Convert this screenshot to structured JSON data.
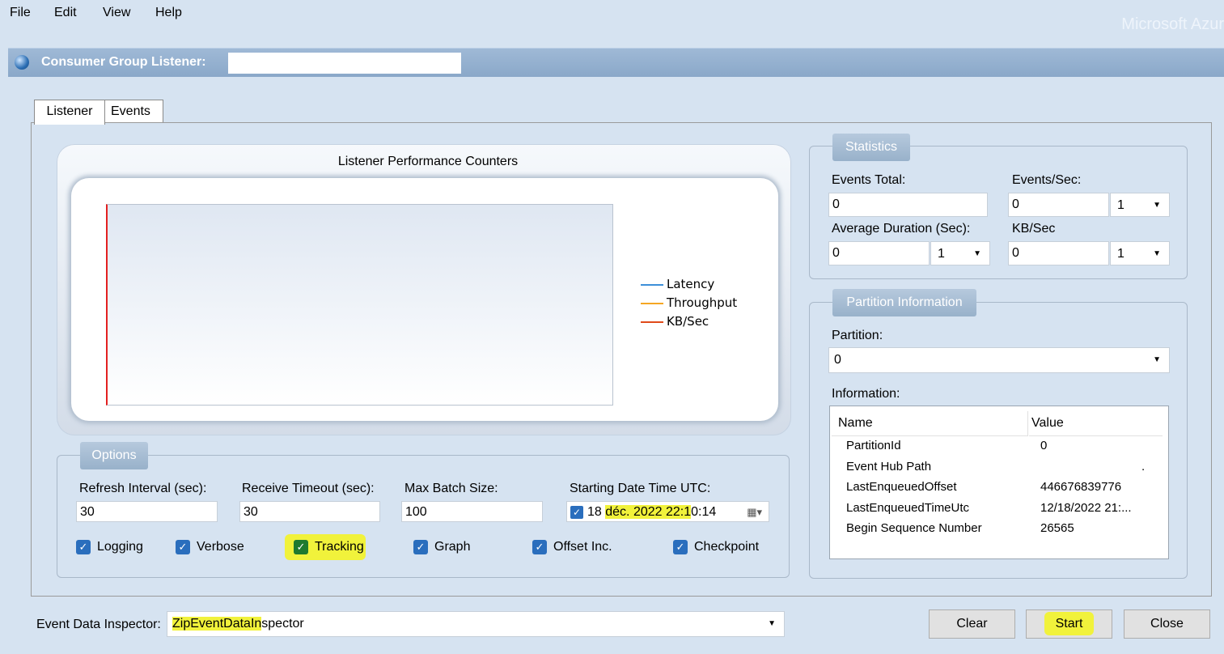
{
  "menu": {
    "items": [
      "File",
      "Edit",
      "View",
      "Help"
    ],
    "brand": "Microsoft Azur"
  },
  "window": {
    "title": "Consumer Group Listener:",
    "title_value": ""
  },
  "tabs": [
    {
      "label": "Listener",
      "active": true
    },
    {
      "label": "Events",
      "active": false
    }
  ],
  "chart": {
    "title": "Listener Performance Counters",
    "legend": [
      {
        "label": "Latency",
        "color": "#3d8fd9"
      },
      {
        "label": "Throughput",
        "color": "#f5a623"
      },
      {
        "label": "KB/Sec",
        "color": "#e04a1a"
      }
    ]
  },
  "options": {
    "label": "Options",
    "refresh_label": "Refresh Interval (sec):",
    "refresh_value": "30",
    "timeout_label": "Receive Timeout (sec):",
    "timeout_value": "30",
    "batch_label": "Max Batch Size:",
    "batch_value": "100",
    "start_label": "Starting Date Time UTC:",
    "start_date_a": "18 ",
    "start_date_b": "déc. 2022 22:1",
    "start_date_c": "0:14",
    "checkboxes": [
      {
        "label": "Logging",
        "checked": true
      },
      {
        "label": "Verbose",
        "checked": true
      },
      {
        "label": "Tracking",
        "checked": true
      },
      {
        "label": "Graph",
        "checked": true
      },
      {
        "label": "Offset Inc.",
        "checked": true
      },
      {
        "label": "Checkpoint",
        "checked": true
      }
    ]
  },
  "statistics": {
    "label": "Statistics",
    "events_total_label": "Events Total:",
    "events_total_value": "0",
    "events_sec_label": "Events/Sec:",
    "events_sec_value": "0",
    "events_sec_select": "1",
    "avg_duration_label": "Average Duration (Sec):",
    "avg_duration_value": "0",
    "avg_duration_select": "1",
    "kb_sec_label": "KB/Sec",
    "kb_sec_value": "0",
    "kb_sec_select": "1"
  },
  "partition": {
    "label": "Partition Information",
    "partition_label": "Partition:",
    "partition_value": "0",
    "information_label": "Information:",
    "columns": [
      "Name",
      "Value"
    ],
    "rows": [
      {
        "name": "PartitionId",
        "value": "0"
      },
      {
        "name": "Event Hub Path",
        "value": "."
      },
      {
        "name": "LastEnqueuedOffset",
        "value": "446676839776"
      },
      {
        "name": "LastEnqueuedTimeUtc",
        "value": "12/18/2022 21:..."
      },
      {
        "name": "Begin Sequence Number",
        "value": "26565"
      }
    ]
  },
  "inspector": {
    "label": "Event Data Inspector:",
    "value_a": "ZipEventDataIn",
    "value_b": "spector"
  },
  "buttons": {
    "clear": "Clear",
    "start": "Start",
    "close": "Close"
  }
}
